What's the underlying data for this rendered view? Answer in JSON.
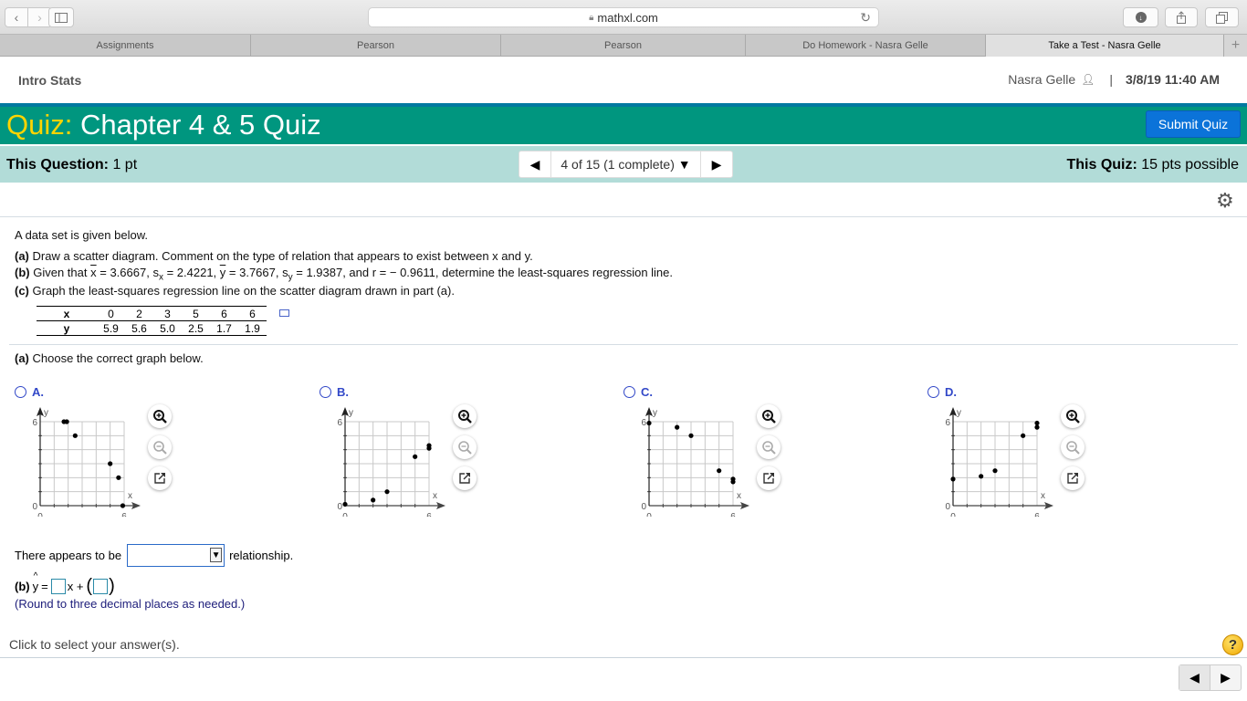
{
  "browser": {
    "url": "mathxl.com",
    "tabs": [
      {
        "label": "Assignments",
        "active": false
      },
      {
        "label": "Pearson",
        "active": false
      },
      {
        "label": "Pearson",
        "active": false
      },
      {
        "label": "Do Homework - Nasra Gelle",
        "active": false
      },
      {
        "label": "Take a Test - Nasra Gelle",
        "active": true
      }
    ],
    "new_tab_label": "+"
  },
  "header": {
    "course": "Intro Stats",
    "user_name": "Nasra Gelle",
    "separator": "|",
    "datetime": "3/8/19 11:40 AM"
  },
  "quiz": {
    "prefix": "Quiz:",
    "title": "Chapter 4 & 5 Quiz",
    "submit_label": "Submit Quiz",
    "question_points_label": "This Question:",
    "question_points_value": "1 pt",
    "progress_label": "4 of 15 (1 complete)",
    "quiz_points_label": "This Quiz:",
    "quiz_points_value": "15 pts possible"
  },
  "question": {
    "intro": "A data set is given below.",
    "part_a_label": "(a)",
    "part_a_text": "Draw a scatter diagram. Comment on the type of relation that appears to exist between x and y.",
    "part_b_label": "(b)",
    "part_b_pre": "Given that",
    "xbar_value": "= 3.6667,",
    "sx_value": "= 2.4221,",
    "ybar_value": "= 3.7667,",
    "sy_value": "= 1.9387, and r = − 0.9611, determine the least-squares regression line.",
    "part_c_label": "(c)",
    "part_c_text": "Graph the least-squares regression line on the scatter diagram drawn in part (a).",
    "table": {
      "x_header": "x",
      "y_header": "y",
      "x_values": [
        "0",
        "2",
        "3",
        "5",
        "6",
        "6"
      ],
      "y_values": [
        "5.9",
        "5.6",
        "5.0",
        "2.5",
        "1.7",
        "1.9"
      ]
    },
    "choose_label": "(a)",
    "choose_text": "Choose the correct graph below.",
    "options": [
      {
        "letter": "A.",
        "points": [
          [
            1.7,
            6.0
          ],
          [
            1.9,
            6.0
          ],
          [
            2.5,
            5.0
          ],
          [
            5.0,
            3.0
          ],
          [
            5.6,
            2.0
          ],
          [
            5.9,
            0.0
          ]
        ]
      },
      {
        "letter": "B.",
        "points": [
          [
            0,
            0.1
          ],
          [
            2,
            0.4
          ],
          [
            3,
            1.0
          ],
          [
            5,
            3.5
          ],
          [
            6,
            4.1
          ],
          [
            6,
            4.3
          ]
        ]
      },
      {
        "letter": "C.",
        "points": [
          [
            0,
            5.9
          ],
          [
            2,
            5.6
          ],
          [
            3,
            5.0
          ],
          [
            5,
            2.5
          ],
          [
            6,
            1.7
          ],
          [
            6,
            1.9
          ]
        ]
      },
      {
        "letter": "D.",
        "points": [
          [
            0,
            1.9
          ],
          [
            2,
            2.1
          ],
          [
            3,
            2.5
          ],
          [
            5,
            5.0
          ],
          [
            6,
            5.6
          ],
          [
            6,
            5.9
          ]
        ]
      }
    ],
    "plot_axis": {
      "x_label": "x",
      "y_label": "y",
      "min": 0,
      "max": 6,
      "tick_min_label": "0",
      "tick_max_label": "6"
    },
    "relationship_pre": "There appears to be",
    "relationship_value": "",
    "relationship_post": "relationship.",
    "part_b_answer_label": "(b)",
    "yhat_text": "y",
    "eq_equals": "=",
    "eq_x_plus": "x +",
    "slope_value": "",
    "intercept_value": "",
    "round_note": "(Round to three decimal places as needed.)"
  },
  "footer": {
    "click_note": "Click to select your answer(s).",
    "help_label": "?"
  }
}
